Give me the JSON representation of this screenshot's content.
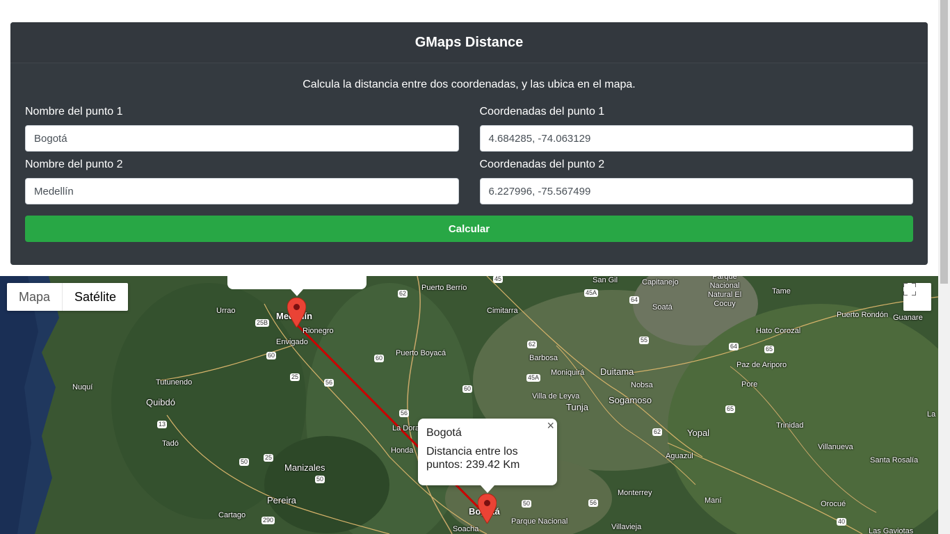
{
  "app": {
    "title": "GMaps Distance",
    "subtitle": "Calcula la distancia entre dos coordenadas, y las ubica en el mapa."
  },
  "form": {
    "point1_name_label": "Nombre del punto 1",
    "point1_name_value": "Bogotá",
    "point1_coords_label": "Coordenadas del punto 1",
    "point1_coords_value": "4.684285, -74.063129",
    "point2_name_label": "Nombre del punto 2",
    "point2_name_value": "Medellín",
    "point2_coords_label": "Coordenadas del punto 2",
    "point2_coords_value": "6.227996, -75.567499",
    "submit_label": "Calcular"
  },
  "map": {
    "type_options": [
      "Mapa",
      "Satélite"
    ],
    "selected_type": "Satélite",
    "infowindow": {
      "title": "Bogotá",
      "text": "Distancia entre los puntos: 239.42 Km",
      "close_symbol": "×"
    },
    "places": [
      {
        "name": "Medellín",
        "size": "big"
      },
      {
        "name": "Rionegro"
      },
      {
        "name": "Envigado"
      },
      {
        "name": "Urrao"
      },
      {
        "name": "Puerto Berrío"
      },
      {
        "name": "Cimitarra"
      },
      {
        "name": "San Gil"
      },
      {
        "name": "Capitanejo"
      },
      {
        "name": "Parque Nacional Natural El Cocuy"
      },
      {
        "name": "Tame"
      },
      {
        "name": "Soatá"
      },
      {
        "name": "Puerto Rondón"
      },
      {
        "name": "Guanare"
      },
      {
        "name": "Hato Corozal"
      },
      {
        "name": "Paz de Ariporo"
      },
      {
        "name": "Nuquí"
      },
      {
        "name": "Tutunendo"
      },
      {
        "name": "Quibdó"
      },
      {
        "name": "Puerto Boyacá"
      },
      {
        "name": "Barbosa"
      },
      {
        "name": "Moniquirá"
      },
      {
        "name": "Duitama"
      },
      {
        "name": "Nobsa"
      },
      {
        "name": "Villa de Leyva"
      },
      {
        "name": "Sogamoso"
      },
      {
        "name": "Tunja"
      },
      {
        "name": "Pore"
      },
      {
        "name": "La Dora"
      },
      {
        "name": "Honda"
      },
      {
        "name": "Trinidad"
      },
      {
        "name": "Yopal"
      },
      {
        "name": "Aguazul"
      },
      {
        "name": "Villanueva"
      },
      {
        "name": "Santa Rosalía"
      },
      {
        "name": "Manizales",
        "size": "big"
      },
      {
        "name": "Pereira",
        "size": "big"
      },
      {
        "name": "Cartago"
      },
      {
        "name": "Tadó"
      },
      {
        "name": "Monterrey"
      },
      {
        "name": "Maní"
      },
      {
        "name": "Orocué"
      },
      {
        "name": "Las Gaviotas"
      },
      {
        "name": "Bogotá",
        "size": "big"
      },
      {
        "name": "Soacha"
      },
      {
        "name": "Parque Nacional"
      },
      {
        "name": "Villavieja"
      },
      {
        "name": "La"
      }
    ],
    "road_shields": [
      "45",
      "62",
      "64",
      "45A",
      "25B",
      "60",
      "25",
      "56",
      "60",
      "62",
      "45A",
      "55",
      "64",
      "65",
      "60",
      "56",
      "65",
      "13",
      "62",
      "25",
      "50",
      "50",
      "290",
      "50",
      "56",
      "40"
    ]
  }
}
